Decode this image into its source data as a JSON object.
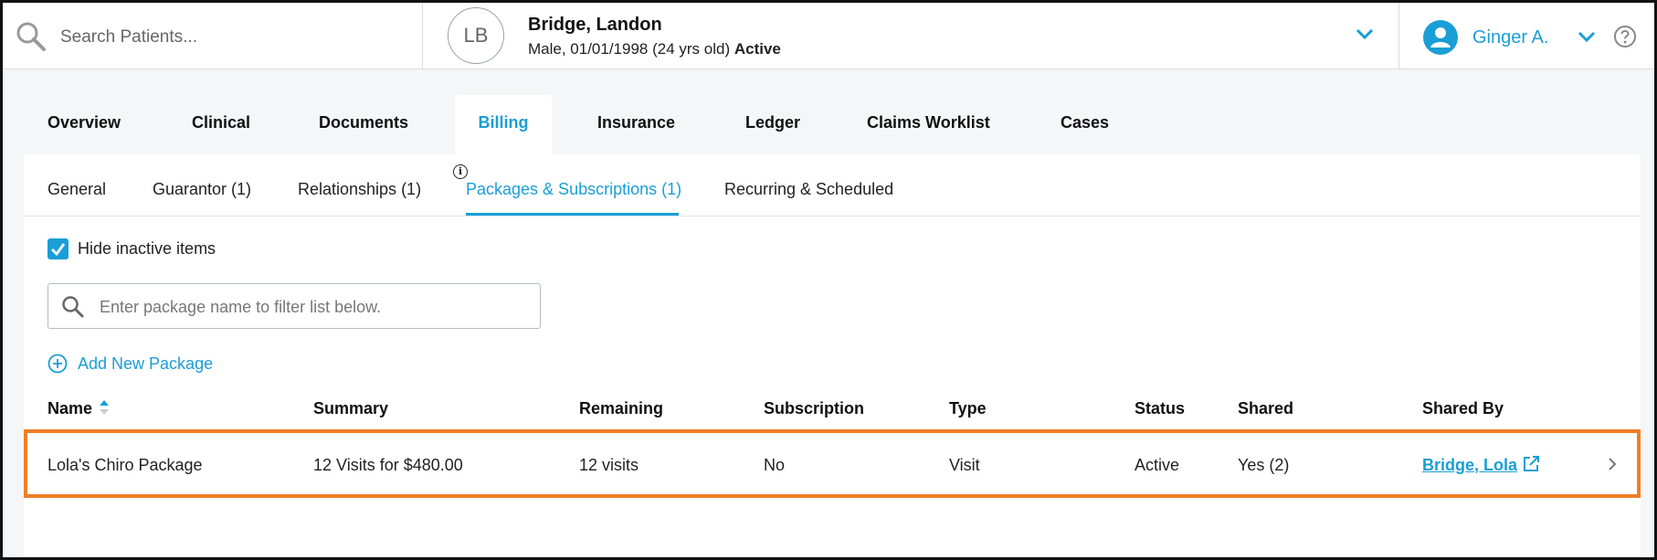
{
  "header": {
    "search_placeholder": "Search Patients...",
    "patient": {
      "initials": "LB",
      "name": "Bridge, Landon",
      "demographics": "Male, 01/01/1998 (24 yrs old)",
      "status": "Active"
    },
    "user": {
      "name": "Ginger A."
    }
  },
  "main_tabs": [
    {
      "label": "Overview"
    },
    {
      "label": "Clinical"
    },
    {
      "label": "Documents"
    },
    {
      "label": "Billing"
    },
    {
      "label": "Insurance"
    },
    {
      "label": "Ledger"
    },
    {
      "label": "Claims Worklist"
    },
    {
      "label": "Cases"
    }
  ],
  "active_main_tab": "Billing",
  "sub_tabs": [
    {
      "label": "General"
    },
    {
      "label": "Guarantor (1)"
    },
    {
      "label": "Relationships (1)"
    },
    {
      "label": "Packages & Subscriptions (1)"
    },
    {
      "label": "Recurring & Scheduled"
    }
  ],
  "active_sub_tab": "Packages & Subscriptions (1)",
  "info_glyph": "i",
  "filters": {
    "hide_inactive_label": "Hide inactive items",
    "hide_inactive_checked": true,
    "package_filter_placeholder": "Enter package name to filter list below."
  },
  "add_package_label": "Add New Package",
  "table": {
    "headers": [
      "Name",
      "Summary",
      "Remaining",
      "Subscription",
      "Type",
      "Status",
      "Shared",
      "Shared By"
    ],
    "rows": [
      {
        "name": "Lola's Chiro Package",
        "summary": "12 Visits for $480.00",
        "remaining": "12 visits",
        "subscription": "No",
        "type": "Visit",
        "status": "Active",
        "shared": "Yes (2)",
        "shared_by": "Bridge, Lola"
      }
    ]
  },
  "colors": {
    "accent": "#1a9ed6",
    "highlight_border": "#f07e26",
    "page_bg": "#f4f6f8"
  }
}
